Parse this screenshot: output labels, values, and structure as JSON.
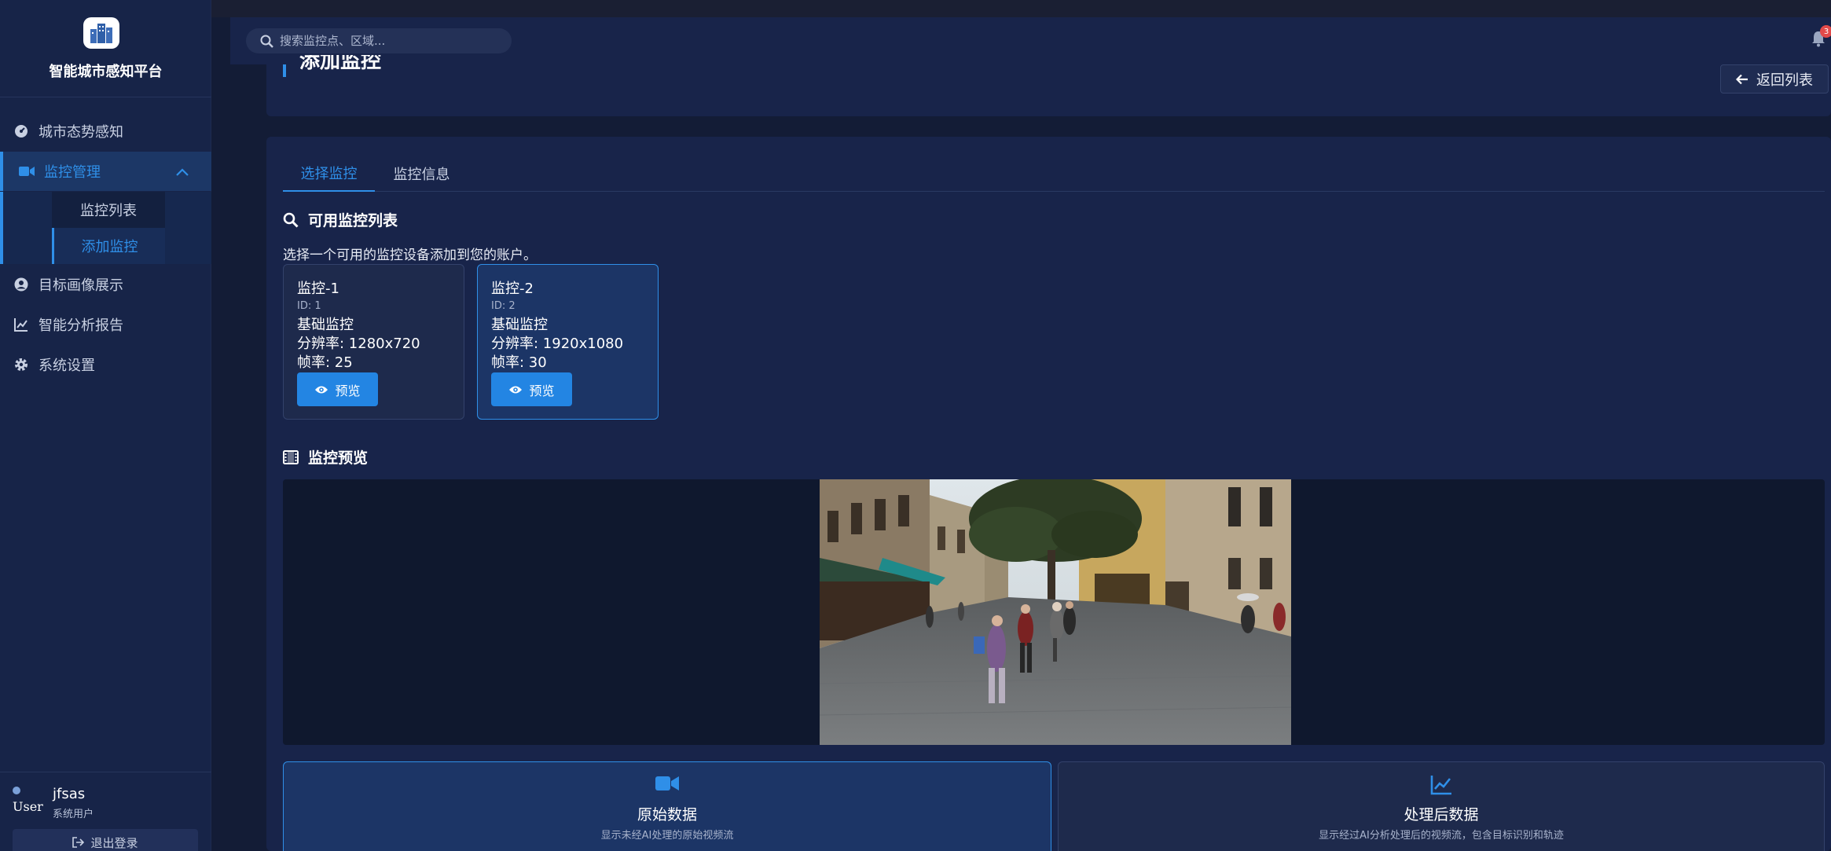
{
  "brand": {
    "title": "智能城市感知平台",
    "logo_icon": "city-buildings-icon"
  },
  "sidebar": {
    "items": [
      {
        "label": "城市态势感知",
        "icon": "dashboard-gauge-icon"
      },
      {
        "label": "监控管理",
        "icon": "video-camera-icon",
        "active": true
      },
      {
        "label": "目标画像展示",
        "icon": "user-circle-icon"
      },
      {
        "label": "智能分析报告",
        "icon": "line-chart-icon"
      },
      {
        "label": "系统设置",
        "icon": "gear-icon"
      }
    ],
    "sub_items": [
      {
        "label": "监控列表"
      },
      {
        "label": "添加监控",
        "active": true
      }
    ]
  },
  "user": {
    "avatar_text": "User",
    "name": "jfsas",
    "role": "系统用户",
    "logout_label": "退出登录"
  },
  "topbar": {
    "search_placeholder": "搜索监控点、区域...",
    "notification_count": "3"
  },
  "header": {
    "title": "添加监控",
    "back_label": "返回列表"
  },
  "tabs": [
    {
      "label": "选择监控",
      "active": true
    },
    {
      "label": "监控信息"
    }
  ],
  "available": {
    "title": "可用监控列表",
    "description": "选择一个可用的监控设备添加到您的账户。",
    "cameras": [
      {
        "name": "监控-1",
        "id": "ID: 1",
        "type": "基础监控",
        "resolution": "分辨率: 1280x720",
        "fps": "帧率: 25",
        "preview_label": "预览",
        "selected": false
      },
      {
        "name": "监控-2",
        "id": "ID: 2",
        "type": "基础监控",
        "resolution": "分辨率: 1920x1080",
        "fps": "帧率: 30",
        "preview_label": "预览",
        "selected": true
      }
    ]
  },
  "preview": {
    "title": "监控预览"
  },
  "modes": [
    {
      "title": "原始数据",
      "description": "显示未经AI处理的原始视频流",
      "icon": "video-camera-icon",
      "selected": true
    },
    {
      "title": "处理后数据",
      "description": "显示经过AI分析处理后的视频流，包含目标识别和轨迹",
      "icon": "line-chart-icon",
      "selected": false
    }
  ],
  "colors": {
    "accent": "#2f8fe8",
    "sidebar_bg": "#172448",
    "card_bg": "#18244a",
    "page_bg": "#131c36"
  }
}
